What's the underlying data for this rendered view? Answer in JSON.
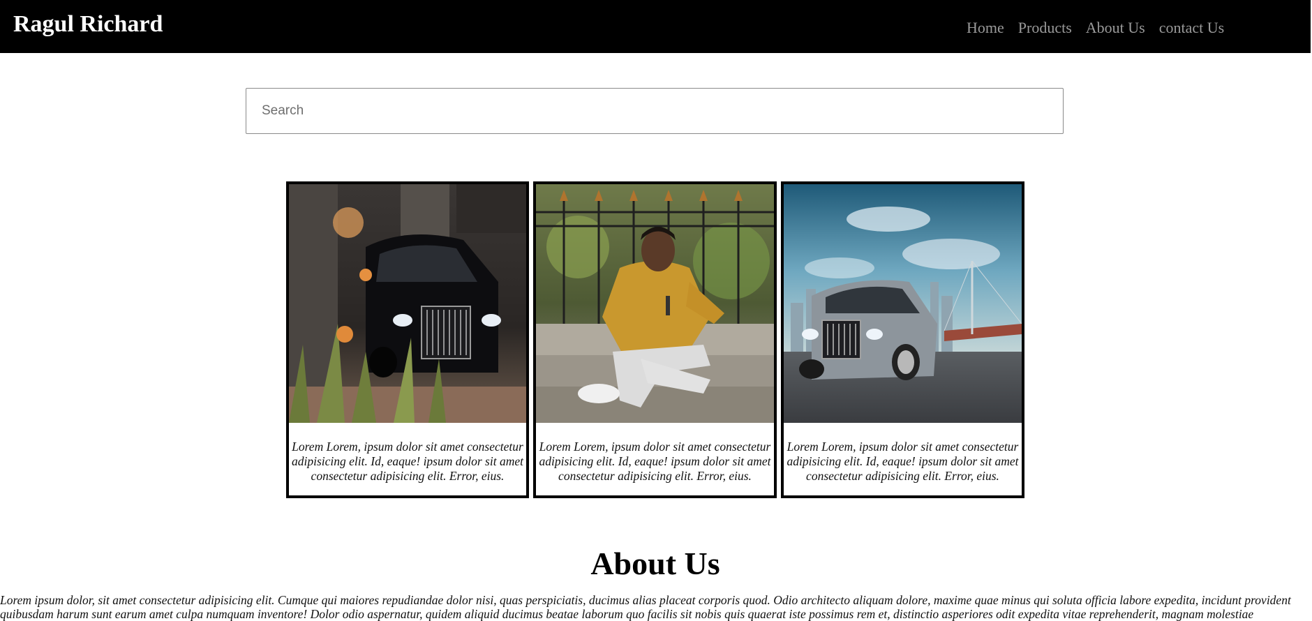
{
  "navbar": {
    "brand": "Ragul Richard",
    "links": [
      "Home",
      "Products",
      "About Us",
      "contact Us"
    ]
  },
  "search": {
    "placeholder": "Search",
    "value": ""
  },
  "cards": [
    {
      "image": "black luxury car with flowers",
      "caption": "Lorem Lorem, ipsum dolor sit amet consectetur adipisicing elit. Id, eaque! ipsum dolor sit amet consectetur adipisicing elit. Error, eius."
    },
    {
      "image": "man in yellow shirt sitting",
      "caption": "Lorem Lorem, ipsum dolor sit amet consectetur adipisicing elit. Id, eaque! ipsum dolor sit amet consectetur adipisicing elit. Error, eius."
    },
    {
      "image": "silver luxury car with bridge",
      "caption": "Lorem Lorem, ipsum dolor sit amet consectetur adipisicing elit. Id, eaque! ipsum dolor sit amet consectetur adipisicing elit. Error, eius."
    }
  ],
  "about": {
    "title": "About Us",
    "text": "Lorem ipsum dolor, sit amet consectetur adipisicing elit. Cumque qui maiores repudiandae dolor nisi, quas perspiciatis, ducimus alias placeat corporis quod. Odio architecto aliquam dolore, maxime quae minus qui soluta officia labore expedita, incidunt provident quibusdam harum sunt earum amet culpa numquam inventore! Dolor odio aspernatur, quidem aliquid ducimus beatae laborum quo facilis sit nobis quis quaerat iste possimus rem et, distinctio asperiores odit expedita vitae reprehenderit, magnam molestiae"
  },
  "colors": {
    "navbar_bg": "#000000",
    "nav_link": "#9a9a9a",
    "brand": "#ffffff",
    "card_border": "#000000"
  }
}
